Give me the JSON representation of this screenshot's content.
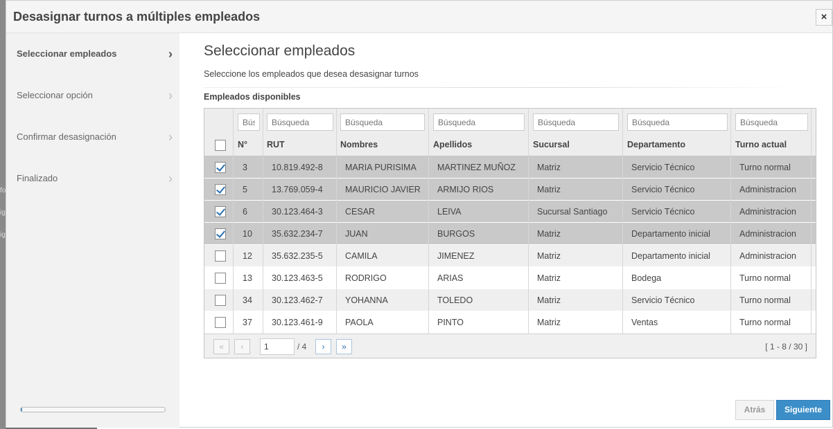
{
  "modal": {
    "title": "Desasignar turnos a múltiples empleados",
    "close_label": "×"
  },
  "background": {
    "fragments": [
      "fo",
      "ig",
      "ig"
    ]
  },
  "steps": [
    {
      "label": "Seleccionar empleados",
      "active": true
    },
    {
      "label": "Seleccionar opción",
      "active": false
    },
    {
      "label": "Confirmar desasignación",
      "active": false
    },
    {
      "label": "Finalizado",
      "active": false
    }
  ],
  "progress": 0.01,
  "main": {
    "title": "Seleccionar empleados",
    "subtitle": "Seleccione los empleados que desea desasignar turnos",
    "section_label": "Empleados disponibles"
  },
  "table": {
    "filter_placeholder": "Búsqueda",
    "headers": [
      "N°",
      "RUT",
      "Nombres",
      "Apellidos",
      "Sucursal",
      "Departamento",
      "Turno actual"
    ],
    "rows": [
      {
        "checked": true,
        "n": "3",
        "rut": "10.819.492-8",
        "nombres": "MARIA PURISIMA",
        "apellidos": "MARTINEZ MUÑOZ",
        "sucursal": "Matriz",
        "departamento": "Servicio Técnico",
        "turno": "Turno normal"
      },
      {
        "checked": true,
        "n": "5",
        "rut": "13.769.059-4",
        "nombres": "MAURICIO JAVIER",
        "apellidos": "ARMIJO RIOS",
        "sucursal": "Matriz",
        "departamento": "Servicio Técnico",
        "turno": "Administracion"
      },
      {
        "checked": true,
        "n": "6",
        "rut": "30.123.464-3",
        "nombres": "CESAR",
        "apellidos": "LEIVA",
        "sucursal": "Sucursal Santiago",
        "departamento": "Servicio Técnico",
        "turno": "Administracion"
      },
      {
        "checked": true,
        "n": "10",
        "rut": "35.632.234-7",
        "nombres": "JUAN",
        "apellidos": "BURGOS",
        "sucursal": "Matriz",
        "departamento": "Departamento inicial",
        "turno": "Administracion"
      },
      {
        "checked": false,
        "n": "12",
        "rut": "35.632.235-5",
        "nombres": "CAMILA",
        "apellidos": "JIMENEZ",
        "sucursal": "Matriz",
        "departamento": "Departamento inicial",
        "turno": "Administracion"
      },
      {
        "checked": false,
        "n": "13",
        "rut": "30.123.463-5",
        "nombres": "RODRIGO",
        "apellidos": "ARIAS",
        "sucursal": "Matriz",
        "departamento": "Bodega",
        "turno": "Turno normal"
      },
      {
        "checked": false,
        "n": "34",
        "rut": "30.123.462-7",
        "nombres": "YOHANNA",
        "apellidos": "TOLEDO",
        "sucursal": "Matriz",
        "departamento": "Servicio Técnico",
        "turno": "Turno normal"
      },
      {
        "checked": false,
        "n": "37",
        "rut": "30.123.461-9",
        "nombres": "PAOLA",
        "apellidos": "PINTO",
        "sucursal": "Matriz",
        "departamento": "Ventas",
        "turno": "Turno normal"
      }
    ]
  },
  "pager": {
    "first": "«",
    "prev": "‹",
    "next": "›",
    "last": "»",
    "page": "1",
    "total": "/ 4",
    "info": "[ 1 - 8 / 30 ]"
  },
  "footer": {
    "back_label": "Atrás",
    "next_label": "Siguiente"
  },
  "colors": {
    "accent": "#3b8ec8",
    "selected_row": "#c9c9c9"
  }
}
